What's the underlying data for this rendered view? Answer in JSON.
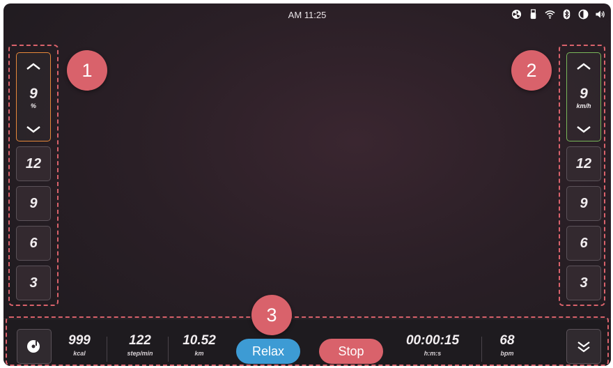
{
  "status_bar": {
    "time": "AM 11:25",
    "icons": [
      "fan-icon",
      "usb-icon",
      "wifi-icon",
      "bluetooth-icon",
      "brightness-icon",
      "volume-icon"
    ]
  },
  "incline": {
    "value": "9",
    "unit": "%",
    "presets": [
      "12",
      "9",
      "6",
      "3"
    ]
  },
  "speed": {
    "value": "9",
    "unit": "km/h",
    "presets": [
      "12",
      "9",
      "6",
      "3"
    ]
  },
  "callouts": [
    "1",
    "2",
    "3"
  ],
  "metrics": {
    "calories": {
      "value": "999",
      "unit": "kcal"
    },
    "cadence": {
      "value": "122",
      "unit": "step/min"
    },
    "distance": {
      "value": "10.52",
      "unit": "km"
    },
    "time": {
      "value": "00:00:15",
      "unit": "h:m:s"
    },
    "heart_rate": {
      "value": "68",
      "unit": "bpm"
    }
  },
  "buttons": {
    "relax": "Relax",
    "stop": "Stop"
  },
  "colors": {
    "incline_accent": "#e8893a",
    "speed_accent": "#79b85a",
    "relax": "#3d9bd4",
    "stop": "#d9626b",
    "callout": "#d9626b"
  }
}
